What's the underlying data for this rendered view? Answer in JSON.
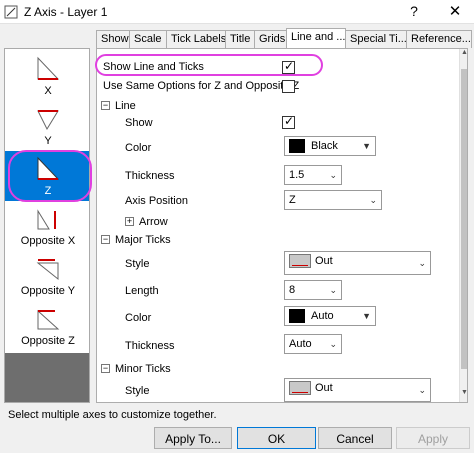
{
  "window": {
    "title": "Z Axis - Layer 1",
    "help_label": "?",
    "close_label": "✕"
  },
  "axes": [
    {
      "label": "X",
      "icon": "x-axis-icon"
    },
    {
      "label": "Y",
      "icon": "y-axis-icon"
    },
    {
      "label": "Z",
      "icon": "z-axis-icon",
      "selected": true
    },
    {
      "label": "Opposite X",
      "icon": "opposite-x-axis-icon"
    },
    {
      "label": "Opposite Y",
      "icon": "opposite-y-axis-icon"
    },
    {
      "label": "Opposite Z",
      "icon": "opposite-z-axis-icon"
    }
  ],
  "tabs": [
    "Show",
    "Scale",
    "Tick Labels",
    "Title",
    "Grids",
    "Line and ...",
    "Special Ti...",
    "Reference..."
  ],
  "active_tab": "Line and ...",
  "form": {
    "show_line_ticks": {
      "label": "Show Line and Ticks",
      "checked": true
    },
    "same_options": {
      "label": "Use Same Options for Z and Opposite Z",
      "checked": false
    },
    "line_group": {
      "label": "Line",
      "show": {
        "label": "Show",
        "checked": true
      },
      "color": {
        "label": "Color",
        "value": "Black"
      },
      "thickness": {
        "label": "Thickness",
        "value": "1.5"
      },
      "axis_position": {
        "label": "Axis Position",
        "value": "Z"
      },
      "arrow": {
        "label": "Arrow"
      }
    },
    "major_ticks": {
      "label": "Major Ticks",
      "style": {
        "label": "Style",
        "value": "Out"
      },
      "length": {
        "label": "Length",
        "value": "8"
      },
      "color": {
        "label": "Color",
        "value": "Auto"
      },
      "thickness": {
        "label": "Thickness",
        "value": "Auto"
      }
    },
    "minor_ticks": {
      "label": "Minor Ticks",
      "style": {
        "label": "Style",
        "value": "Out"
      }
    }
  },
  "status": "Select multiple axes to customize together.",
  "buttons": {
    "apply_to": "Apply To...",
    "ok": "OK",
    "cancel": "Cancel",
    "apply": "Apply"
  },
  "colors": {
    "selection_blue": "#0078d7",
    "highlight_magenta": "#e040e0",
    "tick_red": "#cc0000"
  }
}
